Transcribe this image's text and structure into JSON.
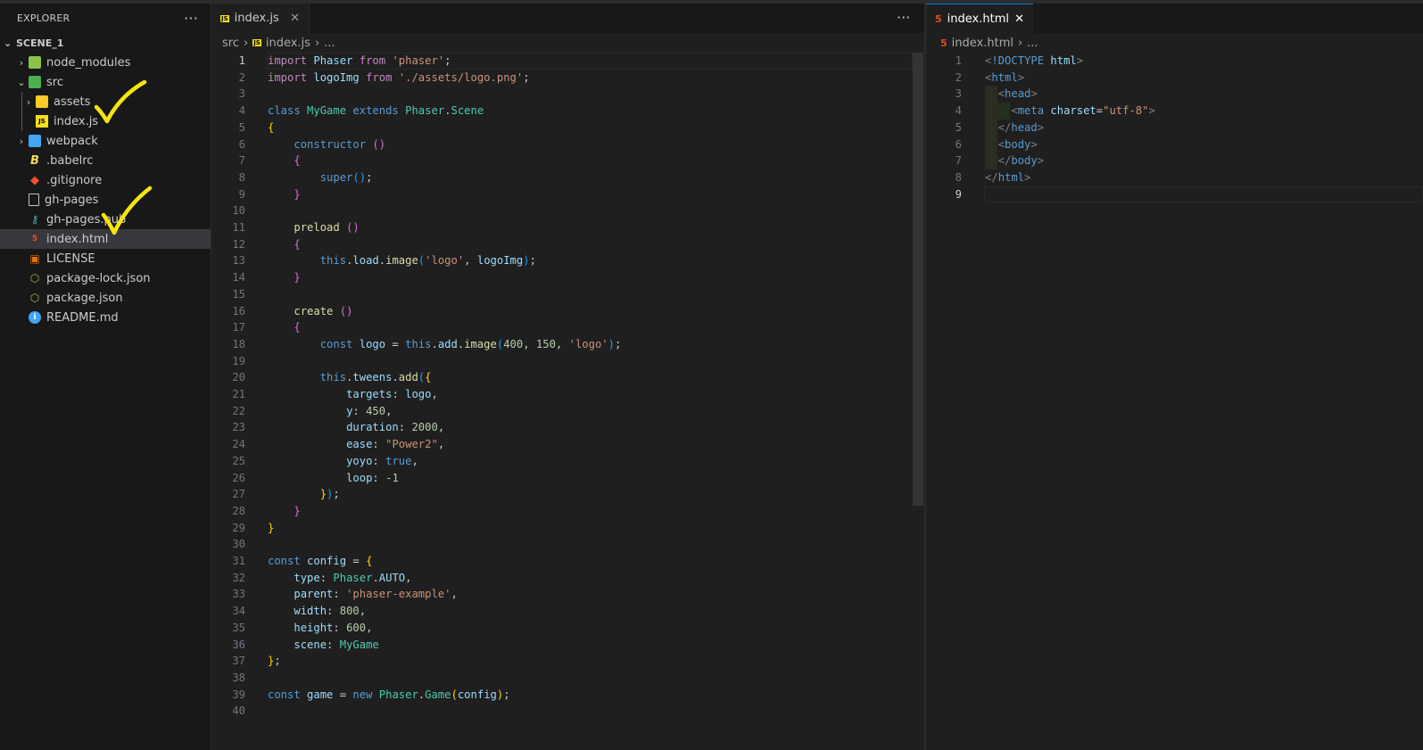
{
  "explorer": {
    "title": "EXPLORER",
    "more": "···",
    "root": "SCENE_1",
    "items": [
      {
        "label": "node_modules",
        "icon": "folder-node-icon",
        "chevron": "›"
      },
      {
        "label": "src",
        "icon": "folder-src-icon",
        "chevron": "⌄"
      },
      {
        "label": "assets",
        "icon": "folder-assets-icon",
        "chevron": "›"
      },
      {
        "label": "index.js",
        "icon": "js-file-icon"
      },
      {
        "label": "webpack",
        "icon": "folder-webpack-icon",
        "chevron": "›"
      },
      {
        "label": ".babelrc",
        "icon": "babel-icon"
      },
      {
        "label": ".gitignore",
        "icon": "git-icon"
      },
      {
        "label": "gh-pages",
        "icon": "file-icon"
      },
      {
        "label": "gh-pages.pub",
        "icon": "key-icon"
      },
      {
        "label": "index.html",
        "icon": "html-file-icon"
      },
      {
        "label": "LICENSE",
        "icon": "license-icon"
      },
      {
        "label": "package-lock.json",
        "icon": "npm-icon"
      },
      {
        "label": "package.json",
        "icon": "npm-icon"
      },
      {
        "label": "README.md",
        "icon": "info-icon"
      }
    ]
  },
  "left_editor": {
    "tab": "index.js",
    "tab_icon": "JS",
    "close": "✕",
    "more": "···",
    "breadcrumb": [
      "src",
      "›",
      "index.js",
      "›",
      "..."
    ],
    "active_line": 1,
    "line_count": 40
  },
  "right_editor": {
    "tab": "index.html",
    "close": "✕",
    "breadcrumb": [
      "index.html",
      "›",
      "..."
    ],
    "active_line": 9,
    "line_count": 9
  },
  "colors": {
    "background": "#1f1f1f",
    "sidebar": "#181818",
    "selection": "#37373d",
    "accent": "#0078d4",
    "annotation": "#f5e50a"
  }
}
